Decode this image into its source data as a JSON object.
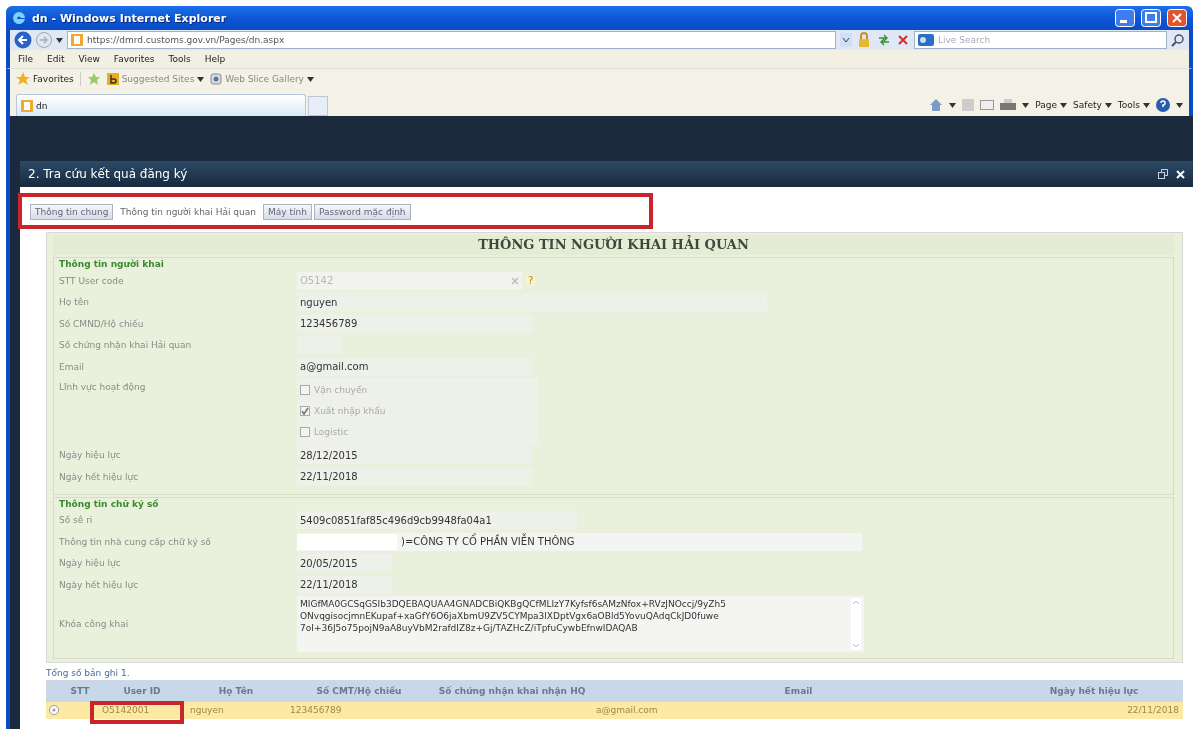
{
  "browser": {
    "title": "dn - Windows Internet Explorer",
    "address": "https://dmrd.customs.gov.vn/Pages/dn.aspx",
    "search": {
      "placeholder": "Live Search"
    },
    "menu": [
      "File",
      "Edit",
      "View",
      "Favorites",
      "Tools",
      "Help"
    ],
    "favorites_bar": {
      "label": "Favorites",
      "links": [
        "Suggested Sites",
        "Web Slice Gallery"
      ]
    },
    "tabs": [
      {
        "label": "dn",
        "selected": true
      }
    ],
    "command_bar": [
      "Page",
      "Safety",
      "Tools"
    ]
  },
  "dialog": {
    "title": "2. Tra cứu kết quả đăng ký",
    "tabs": [
      {
        "label": "Thông tin chung",
        "selected": false
      },
      {
        "label": "Thông tin người khai Hải quan",
        "selected": true
      },
      {
        "label": "Máy tính",
        "selected": false
      },
      {
        "label": "Password mặc định",
        "selected": false
      }
    ],
    "heading": "THÔNG TIN NGƯỜI KHAI HẢI QUAN",
    "sections": [
      {
        "title": "Thông tin người khai",
        "fields": [
          {
            "label": "STT User code",
            "kind": "lookup",
            "value": "O5142",
            "disabled": true,
            "help_mark": "?"
          },
          {
            "label": "Họ tên",
            "kind": "text",
            "value": "nguyen"
          },
          {
            "label": "Số CMND/Hộ chiếu",
            "kind": "text",
            "value": "123456789"
          },
          {
            "label": "Số chứng nhận khai Hải quan",
            "kind": "text"
          },
          {
            "label": "Email",
            "kind": "text",
            "value": "a@gmail.com"
          },
          {
            "label": "Lĩnh vực hoạt động",
            "kind": "checkboxes",
            "disabled": true,
            "options": [
              {
                "label": "Vận chuyển",
                "checked": false
              },
              {
                "label": "Xuất nhập khẩu",
                "checked": true
              },
              {
                "label": "Logistic",
                "checked": false
              }
            ]
          },
          {
            "label": "Ngày hiệu lực",
            "kind": "text",
            "value": "28/12/2015"
          },
          {
            "label": "Ngày hết hiệu lực",
            "kind": "text",
            "value": "22/11/2018"
          }
        ]
      },
      {
        "title": "Thông tin chữ ký số",
        "fields": [
          {
            "label": "Số sê ri",
            "kind": "text",
            "value": "5409c0851faf85c496d9cb9948fa04a1"
          },
          {
            "label": "Thông tin nhà cung cấp chữ ký số",
            "kind": "text",
            "redacted": true,
            "value": ")=CÔNG TY CỔ PHẦN VIỄN THÔNG"
          },
          {
            "label": "Ngày hiệu lực",
            "kind": "text",
            "value": "20/05/2015"
          },
          {
            "label": "Ngày hết hiệu lực",
            "kind": "text",
            "value": "22/11/2018"
          },
          {
            "label": "Khóa công khai",
            "kind": "textarea",
            "lines": [
              "MIGfMA0GCSqGSIb3DQEBAQUAA4GNADCBiQKBgQCfMLIzY7Kyfsf6sAMzNfox+RVzJNOccj/9yZh5",
              "ONvqgisocjmnEKupaf+xaGfY6O6jaXbmU9ZV5CYMpa3lXDptVgx6aOBld5YovuQAdqCkJD0fuwe",
              "7oI+36J5o75pojN9aA8uyVbM2rafdIZ8z+Gj/TAZHcZ/iTpfuCywbEfnwIDAQAB"
            ]
          }
        ]
      }
    ],
    "total": "Tổng số bản ghi 1.",
    "table": {
      "columns": [
        "STT",
        "User ID",
        "Họ Tên",
        "Số CMT/Hộ chiếu",
        "Số chứng nhận khai nhận HQ",
        "Email",
        "Ngày hết hiệu lực"
      ],
      "rows": [
        {
          "user_id": "O5142001",
          "name": "nguyen",
          "id_number": "123456789",
          "email": "a@gmail.com",
          "expiry": "22/11/2018",
          "selected": true
        }
      ]
    },
    "annotations": {
      "tabs_boxed": true,
      "user_id_boxed": true
    }
  }
}
